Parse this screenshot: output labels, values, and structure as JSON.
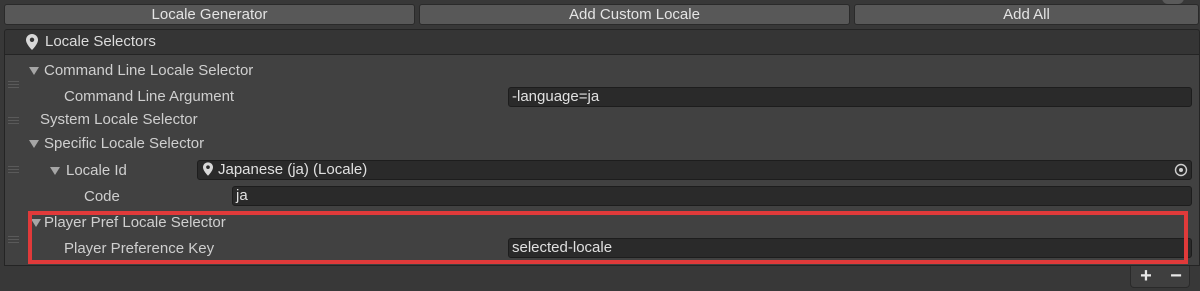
{
  "toolbar": {
    "locale_generator": "Locale Generator",
    "add_custom_locale": "Add Custom Locale",
    "add_all": "Add All"
  },
  "header": {
    "title": "Locale Selectors",
    "icon": "location-pin-icon"
  },
  "selectors": {
    "command_line": {
      "title": "Command Line Locale Selector",
      "arg_label": "Command Line Argument",
      "arg_value": "-language=ja"
    },
    "system": {
      "title": "System Locale Selector"
    },
    "specific": {
      "title": "Specific Locale Selector",
      "locale_id_label": "Locale Id",
      "locale_id_value": "Japanese (ja) (Locale)",
      "code_label": "Code",
      "code_value": "ja"
    },
    "player_pref": {
      "title": "Player Pref Locale Selector",
      "key_label": "Player Preference Key",
      "key_value": "selected-locale"
    }
  },
  "list_controls": {
    "add": "+",
    "remove": "−"
  },
  "colors": {
    "highlight": "#e03a3a",
    "button_bg": "#585858",
    "field_bg": "#2a2a2a"
  }
}
